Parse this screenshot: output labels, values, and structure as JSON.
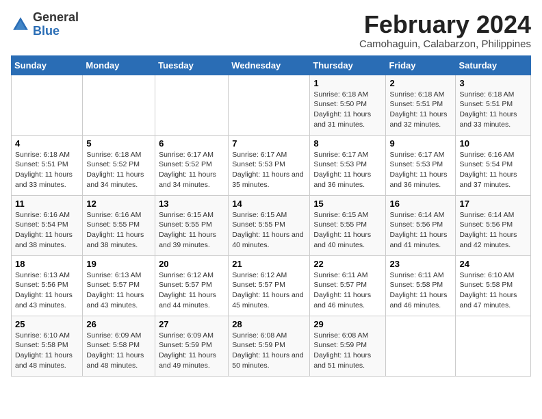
{
  "logo": {
    "general": "General",
    "blue": "Blue"
  },
  "title": "February 2024",
  "subtitle": "Camohaguin, Calabarzon, Philippines",
  "days_header": [
    "Sunday",
    "Monday",
    "Tuesday",
    "Wednesday",
    "Thursday",
    "Friday",
    "Saturday"
  ],
  "weeks": [
    [
      {
        "day": "",
        "info": ""
      },
      {
        "day": "",
        "info": ""
      },
      {
        "day": "",
        "info": ""
      },
      {
        "day": "",
        "info": ""
      },
      {
        "day": "1",
        "info": "Sunrise: 6:18 AM\nSunset: 5:50 PM\nDaylight: 11 hours and 31 minutes."
      },
      {
        "day": "2",
        "info": "Sunrise: 6:18 AM\nSunset: 5:51 PM\nDaylight: 11 hours and 32 minutes."
      },
      {
        "day": "3",
        "info": "Sunrise: 6:18 AM\nSunset: 5:51 PM\nDaylight: 11 hours and 33 minutes."
      }
    ],
    [
      {
        "day": "4",
        "info": "Sunrise: 6:18 AM\nSunset: 5:51 PM\nDaylight: 11 hours and 33 minutes."
      },
      {
        "day": "5",
        "info": "Sunrise: 6:18 AM\nSunset: 5:52 PM\nDaylight: 11 hours and 34 minutes."
      },
      {
        "day": "6",
        "info": "Sunrise: 6:17 AM\nSunset: 5:52 PM\nDaylight: 11 hours and 34 minutes."
      },
      {
        "day": "7",
        "info": "Sunrise: 6:17 AM\nSunset: 5:53 PM\nDaylight: 11 hours and 35 minutes."
      },
      {
        "day": "8",
        "info": "Sunrise: 6:17 AM\nSunset: 5:53 PM\nDaylight: 11 hours and 36 minutes."
      },
      {
        "day": "9",
        "info": "Sunrise: 6:17 AM\nSunset: 5:53 PM\nDaylight: 11 hours and 36 minutes."
      },
      {
        "day": "10",
        "info": "Sunrise: 6:16 AM\nSunset: 5:54 PM\nDaylight: 11 hours and 37 minutes."
      }
    ],
    [
      {
        "day": "11",
        "info": "Sunrise: 6:16 AM\nSunset: 5:54 PM\nDaylight: 11 hours and 38 minutes."
      },
      {
        "day": "12",
        "info": "Sunrise: 6:16 AM\nSunset: 5:55 PM\nDaylight: 11 hours and 38 minutes."
      },
      {
        "day": "13",
        "info": "Sunrise: 6:15 AM\nSunset: 5:55 PM\nDaylight: 11 hours and 39 minutes."
      },
      {
        "day": "14",
        "info": "Sunrise: 6:15 AM\nSunset: 5:55 PM\nDaylight: 11 hours and 40 minutes."
      },
      {
        "day": "15",
        "info": "Sunrise: 6:15 AM\nSunset: 5:55 PM\nDaylight: 11 hours and 40 minutes."
      },
      {
        "day": "16",
        "info": "Sunrise: 6:14 AM\nSunset: 5:56 PM\nDaylight: 11 hours and 41 minutes."
      },
      {
        "day": "17",
        "info": "Sunrise: 6:14 AM\nSunset: 5:56 PM\nDaylight: 11 hours and 42 minutes."
      }
    ],
    [
      {
        "day": "18",
        "info": "Sunrise: 6:13 AM\nSunset: 5:56 PM\nDaylight: 11 hours and 43 minutes."
      },
      {
        "day": "19",
        "info": "Sunrise: 6:13 AM\nSunset: 5:57 PM\nDaylight: 11 hours and 43 minutes."
      },
      {
        "day": "20",
        "info": "Sunrise: 6:12 AM\nSunset: 5:57 PM\nDaylight: 11 hours and 44 minutes."
      },
      {
        "day": "21",
        "info": "Sunrise: 6:12 AM\nSunset: 5:57 PM\nDaylight: 11 hours and 45 minutes."
      },
      {
        "day": "22",
        "info": "Sunrise: 6:11 AM\nSunset: 5:57 PM\nDaylight: 11 hours and 46 minutes."
      },
      {
        "day": "23",
        "info": "Sunrise: 6:11 AM\nSunset: 5:58 PM\nDaylight: 11 hours and 46 minutes."
      },
      {
        "day": "24",
        "info": "Sunrise: 6:10 AM\nSunset: 5:58 PM\nDaylight: 11 hours and 47 minutes."
      }
    ],
    [
      {
        "day": "25",
        "info": "Sunrise: 6:10 AM\nSunset: 5:58 PM\nDaylight: 11 hours and 48 minutes."
      },
      {
        "day": "26",
        "info": "Sunrise: 6:09 AM\nSunset: 5:58 PM\nDaylight: 11 hours and 48 minutes."
      },
      {
        "day": "27",
        "info": "Sunrise: 6:09 AM\nSunset: 5:59 PM\nDaylight: 11 hours and 49 minutes."
      },
      {
        "day": "28",
        "info": "Sunrise: 6:08 AM\nSunset: 5:59 PM\nDaylight: 11 hours and 50 minutes."
      },
      {
        "day": "29",
        "info": "Sunrise: 6:08 AM\nSunset: 5:59 PM\nDaylight: 11 hours and 51 minutes."
      },
      {
        "day": "",
        "info": ""
      },
      {
        "day": "",
        "info": ""
      }
    ]
  ]
}
